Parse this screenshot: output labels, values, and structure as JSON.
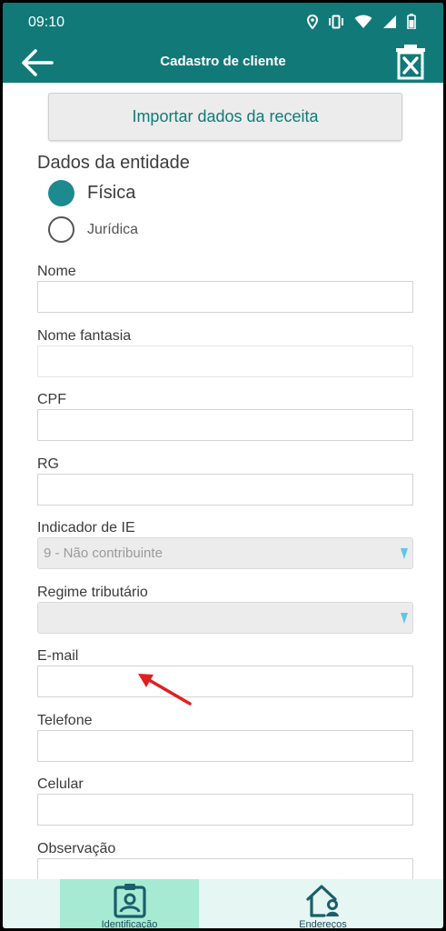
{
  "status_bar": {
    "time": "09:10"
  },
  "app_bar": {
    "title": "Cadastro de cliente"
  },
  "import_button": {
    "label": "Importar dados da receita"
  },
  "entity_section": {
    "title": "Dados da entidade",
    "options": [
      {
        "label": "Física",
        "selected": true
      },
      {
        "label": "Jurídica",
        "selected": false
      }
    ]
  },
  "fields": {
    "nome": {
      "label": "Nome",
      "value": ""
    },
    "nome_fantasia": {
      "label": "Nome fantasia",
      "value": ""
    },
    "cpf": {
      "label": "CPF",
      "value": ""
    },
    "rg": {
      "label": "RG",
      "value": ""
    },
    "indicador_ie": {
      "label": "Indicador de IE",
      "value": "9 - Não contribuinte"
    },
    "regime_tributario": {
      "label": "Regime tributário",
      "value": ""
    },
    "email": {
      "label": "E-mail",
      "value": ""
    },
    "telefone": {
      "label": "Telefone",
      "value": ""
    },
    "celular": {
      "label": "Celular",
      "value": ""
    },
    "observacao": {
      "label": "Observação",
      "value": ""
    }
  },
  "bottom_nav": {
    "tabs": [
      {
        "label": "Identificação",
        "icon": "id-badge-icon",
        "active": true
      },
      {
        "label": "Endereços",
        "icon": "home-user-icon",
        "active": false
      }
    ]
  },
  "colors": {
    "primary": "#117a78",
    "radio_selected": "#1c8a8f",
    "active_tab": "#a6ead4",
    "nav_background": "#e6f6f2",
    "annotation_arrow": "#e02020"
  }
}
